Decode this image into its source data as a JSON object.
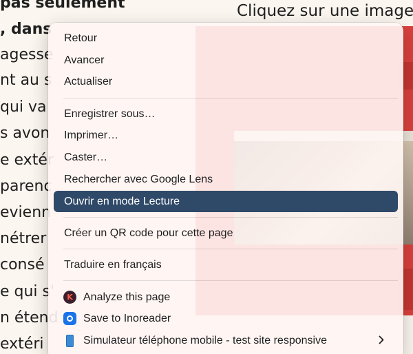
{
  "background": {
    "left_lines": [
      "pas seulement",
      ", dans",
      "agesse",
      "nt au s",
      "qui va",
      "s avon",
      "e extér",
      "parenc",
      "evienn",
      "nétrer",
      "consé",
      "e qui s'",
      "n étend",
      "extéri"
    ],
    "right_title": "Cliquez sur une image"
  },
  "menu": {
    "group1": [
      "Retour",
      "Avancer",
      "Actualiser"
    ],
    "group2": [
      "Enregistrer sous…",
      "Imprimer…",
      "Caster…",
      "Rechercher avec Google Lens",
      "Ouvrir en mode Lecture"
    ],
    "group3": [
      "Créer un QR code pour cette page"
    ],
    "group4": [
      "Traduire en français"
    ],
    "extensions": {
      "analyze": "Analyze this page",
      "inoreader": "Save to Inoreader",
      "simulator": "Simulateur téléphone mobile - test site responsive"
    },
    "selected_item": "Ouvrir en mode Lecture"
  },
  "icons": {
    "analyze": "k-logo-icon",
    "inoreader": "inoreader-icon",
    "simulator": "phone-icon",
    "submenu": "chevron-right-icon"
  },
  "colors": {
    "selection": "#2f4968",
    "menu_background": "#fff6f4",
    "page_background": "#fbf6ef",
    "red_panel": "#d9413c"
  }
}
